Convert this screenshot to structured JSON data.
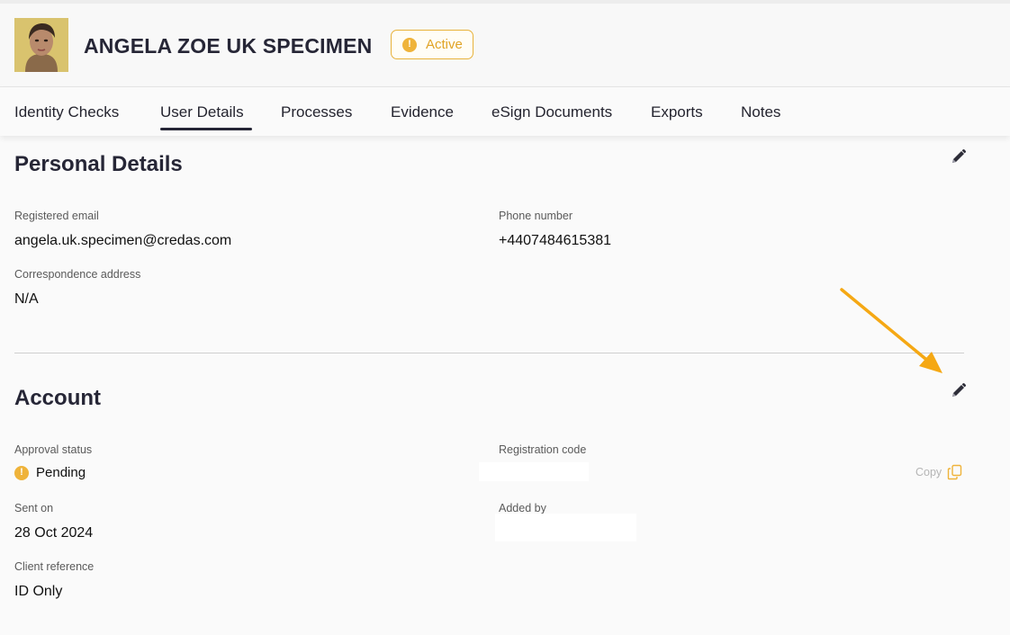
{
  "user": {
    "name": "ANGELA ZOE UK SPECIMEN",
    "status": "Active"
  },
  "tabs": [
    {
      "label": "Identity Checks"
    },
    {
      "label": "User Details"
    },
    {
      "label": "Processes"
    },
    {
      "label": "Evidence"
    },
    {
      "label": "eSign Documents"
    },
    {
      "label": "Exports"
    },
    {
      "label": "Notes"
    }
  ],
  "active_tab": "User Details",
  "personal_details": {
    "title": "Personal Details",
    "registered_email_label": "Registered email",
    "registered_email": "angela.uk.specimen@credas.com",
    "phone_label": "Phone number",
    "phone": "+4407484615381",
    "address_label": "Correspondence address",
    "address": "N/A"
  },
  "account": {
    "title": "Account",
    "approval_label": "Approval status",
    "approval_status": "Pending",
    "registration_label": "Registration code",
    "copy_label": "Copy",
    "sent_on_label": "Sent on",
    "sent_on": "28 Oct 2024",
    "added_by_label": "Added by",
    "client_ref_label": "Client reference",
    "client_ref": "ID Only"
  },
  "colors": {
    "accent_warning": "#efb33a",
    "heading": "#262636",
    "annotation_arrow": "#f5a814"
  },
  "icons": {
    "edit": "pencil-icon",
    "copy": "copy-icon",
    "status": "warning-circle-icon"
  }
}
